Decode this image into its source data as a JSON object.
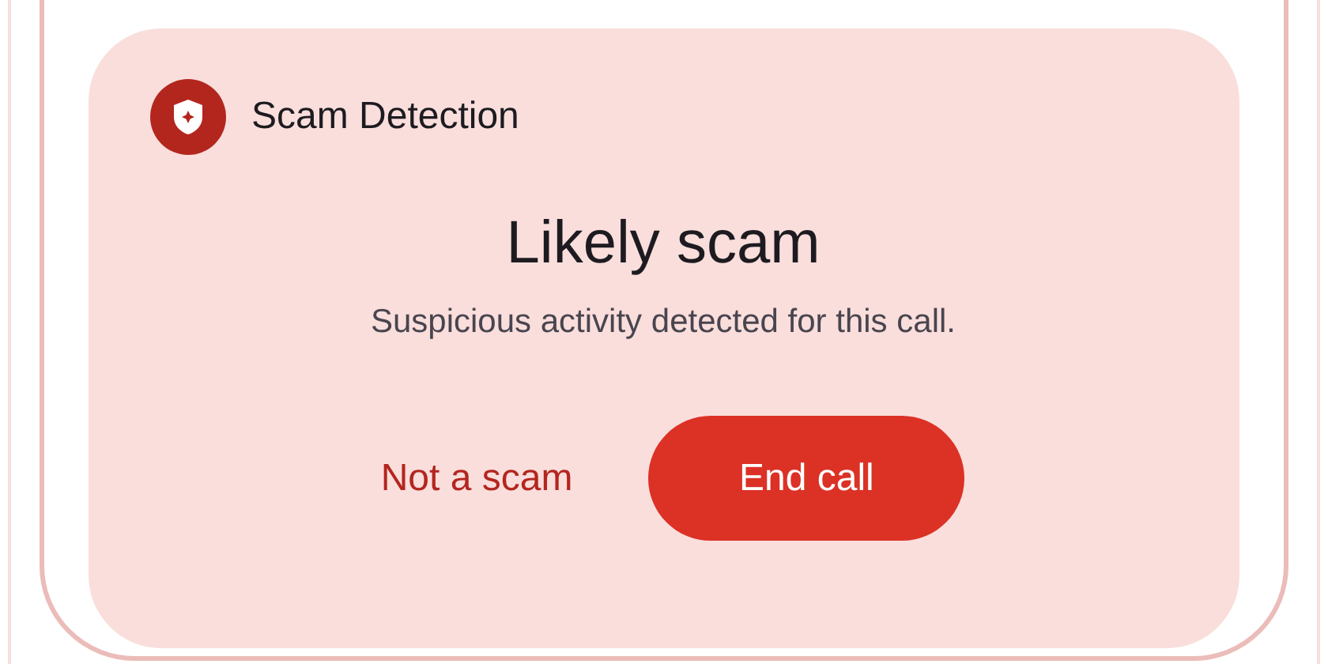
{
  "header": {
    "title": "Scam Detection"
  },
  "headline": "Likely scam",
  "message": "Suspicious activity detected for this call.",
  "actions": [
    {
      "label": "Not a scam",
      "kind": "text"
    },
    {
      "label": "End call",
      "kind": "filled"
    }
  ]
}
